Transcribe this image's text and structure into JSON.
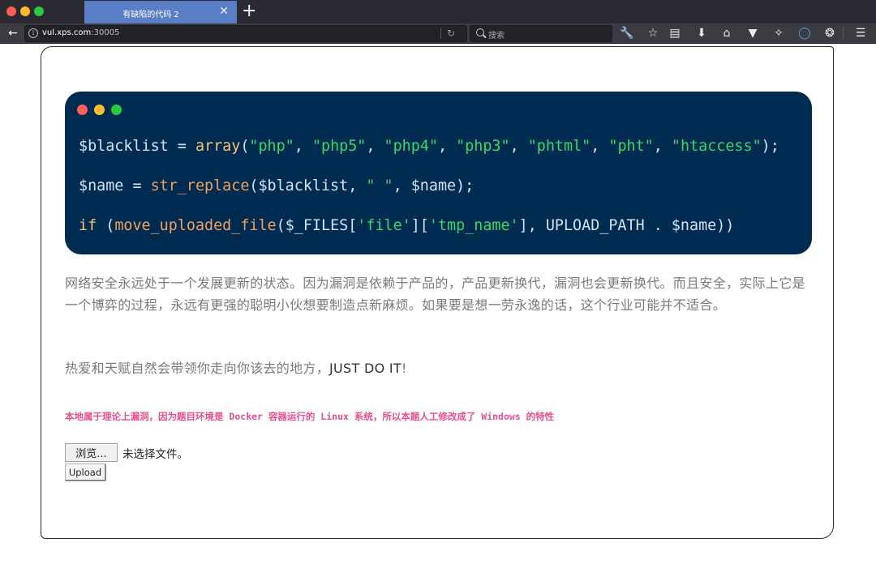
{
  "browser": {
    "tab_title": "有缺陷的代码 2",
    "tab_close": "✕",
    "new_tab": "+",
    "url_host": "vul.xps.com",
    "url_port": ":30005",
    "search_placeholder": "搜索"
  },
  "code": {
    "line1": {
      "var": "$blacklist",
      "eq": " = ",
      "fn": "array",
      "open": "(",
      "items": [
        "\"php\"",
        "\"php5\"",
        "\"php4\"",
        "\"php3\"",
        "\"phtml\"",
        "\"pht\"",
        "\"htaccess\""
      ],
      "sep": ", ",
      "close": ");"
    },
    "line2": {
      "var": "$name",
      "eq": " = ",
      "fn": "str_replace",
      "open": "(",
      "arg1": "$blacklist",
      "sep1": ", ",
      "arg2": "\" \"",
      "sep2": ", ",
      "arg3": "$name",
      "close": ");"
    },
    "line3": {
      "kw": "if",
      "space": " (",
      "fn": "move_uploaded_file",
      "open": "(",
      "arg1": "$_FILES",
      "b1o": "[",
      "k1": "'file'",
      "b1c": "][",
      "k2": "'tmp_name'",
      "b2c": "], ",
      "const": "UPLOAD_PATH",
      "dot": " . ",
      "arg3": "$name",
      "close": "))"
    }
  },
  "paragraph1": "网络安全永远处于一个发展更新的状态。因为漏洞是依赖于产品的，产品更新换代，漏洞也会更新换代。而且安全，实际上它是一个博弈的过程，永远有更强的聪明小伙想要制造点新麻烦。如果要是想一劳永逸的话，这个行业可能并不适合。",
  "paragraph2_prefix": "热爱和天赋自然会带领你走向你该去的地方，",
  "paragraph2_emph": "JUST DO IT",
  "paragraph2_suffix": "!",
  "notice": "本地属于理论上漏洞，因为题目环境是 Docker 容器运行的 Linux 系统，所以本题人工修改成了 Windows 的特性",
  "file_input": {
    "button_label": "浏览...",
    "status": "未选择文件。"
  },
  "upload_label": "Upload"
}
